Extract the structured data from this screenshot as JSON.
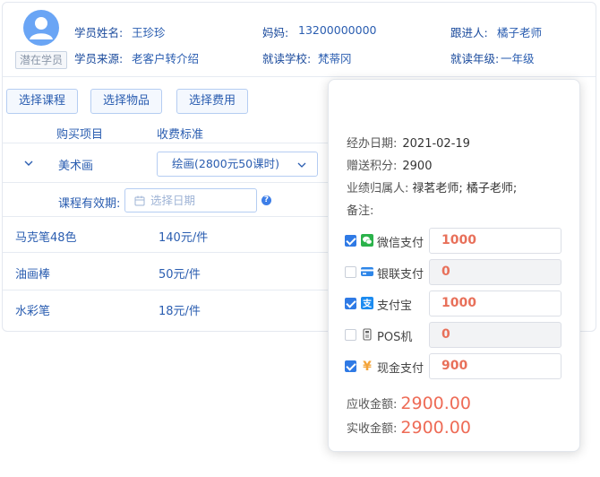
{
  "student": {
    "status_tag": "潜在学员",
    "name_label": "学员姓名:",
    "name_value": "王珍珍",
    "mother_label": "妈妈:",
    "mother_value": "13200000000",
    "follower_label": "跟进人:",
    "follower_value": "橘子老师",
    "source_label": "学员来源:",
    "source_value": "老客户转介绍",
    "school_label": "就读学校:",
    "school_value": "梵蒂冈",
    "grade_label": "就读年级:",
    "grade_value": "一年级"
  },
  "actions": {
    "select_course": "选择课程",
    "select_goods": "选择物品",
    "select_fee": "选择费用"
  },
  "table": {
    "col_item": "购买项目",
    "col_fee": "收费标准",
    "course": {
      "name": "美术画",
      "fee_option": "绘画(2800元50课时)",
      "validity_label": "课程有效期:",
      "date_placeholder": "选择日期"
    },
    "goods": [
      {
        "name": "马克笔48色",
        "price": "140元/件"
      },
      {
        "name": "油画棒",
        "price": "50元/件"
      },
      {
        "name": "水彩笔",
        "price": "18元/件"
      }
    ]
  },
  "payment": {
    "date_label": "经办日期:",
    "date_value": "2021-02-19",
    "points_label": "赠送积分:",
    "points_value": "2900",
    "owner_label": "业绩归属人:",
    "owner_value": "禄茗老师; 橘子老师;",
    "remark_label": "备注:",
    "methods": [
      {
        "label": "微信支付",
        "checked": true,
        "amount": "1000",
        "icon": "wechat-icon"
      },
      {
        "label": "银联支付",
        "checked": false,
        "amount": "0",
        "icon": "unionpay-card-icon"
      },
      {
        "label": "支付宝",
        "checked": true,
        "amount": "1000",
        "icon": "alipay-icon"
      },
      {
        "label": "POS机",
        "checked": false,
        "amount": "0",
        "icon": "pos-terminal-icon"
      },
      {
        "label": "现金支付",
        "checked": true,
        "amount": "900",
        "icon": "yuan-cash-icon"
      }
    ],
    "receivable_label": "应收金额:",
    "receivable_value": "2900.00",
    "received_label": "实收金额:",
    "received_value": "2900.00"
  },
  "colors": {
    "accent_blue": "#2a5db0",
    "avatar_blue": "#6aa5f5",
    "checkbox_blue": "#2f7ae5",
    "amount_red": "#ee6b56",
    "wechat_green": "#2ab24a",
    "alipay_blue": "#1b8bf0",
    "cash_orange": "#f3a43a"
  }
}
